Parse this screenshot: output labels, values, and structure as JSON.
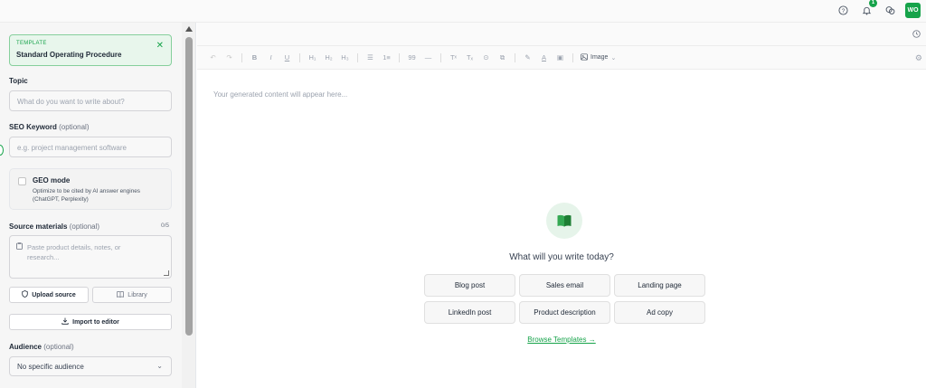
{
  "topbar": {
    "notification_count": "1",
    "avatar_initials": "WO",
    "accent_color": "#16a34a"
  },
  "sidebar": {
    "template": {
      "tag": "TEMPLATE",
      "name": "Standard Operating Procedure"
    },
    "topic": {
      "label": "Topic",
      "placeholder": "What do you want to write about?"
    },
    "seo": {
      "label": "SEO Keyword",
      "optional": "(optional)",
      "placeholder": "e.g. project management software"
    },
    "geo": {
      "title": "GEO mode",
      "description": "Optimize to be cited by AI answer engines (ChatGPT, Perplexity)"
    },
    "source": {
      "label": "Source materials",
      "optional": "(optional)",
      "count": "0/5",
      "placeholder": "Paste product details, notes, or research..."
    },
    "upload_label": "Upload source",
    "library_label": "Library",
    "import_label": "Import to editor",
    "audience": {
      "label": "Audience",
      "optional": "(optional)",
      "value": "No specific audience"
    }
  },
  "editor": {
    "toolbar": [
      "↶",
      "↷",
      "B",
      "I",
      "U",
      "H₁",
      "H₂",
      "H₃",
      "☰",
      "1≡",
      "99",
      "—",
      "Tˣ",
      "Tₓ",
      "⊙",
      "⧉",
      "✎",
      "A",
      "▣"
    ],
    "image_label": "Image",
    "placeholder": "Your generated content will appear here...",
    "prompt": "What will you write today?",
    "chips": [
      "Blog post",
      "Sales email",
      "Landing page",
      "LinkedIn post",
      "Product description",
      "Ad copy"
    ],
    "browse_label": "Browse Templates →"
  }
}
